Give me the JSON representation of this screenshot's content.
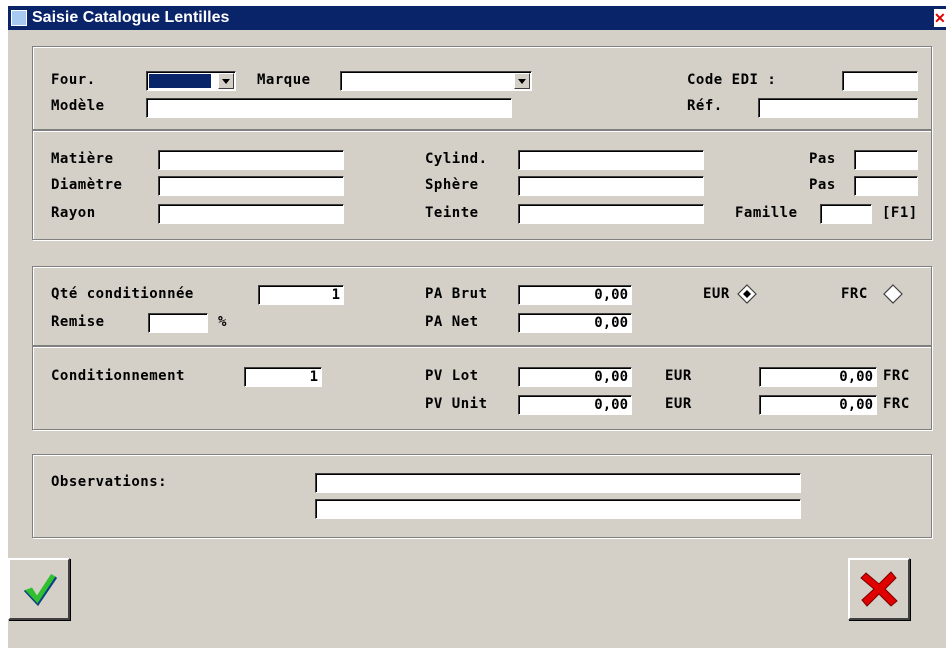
{
  "window": {
    "title": "Saisie Catalogue Lentilles"
  },
  "colors": {
    "titlebar": "#0a246a",
    "face": "#d4d0c8",
    "close": "#e00000",
    "ok_check": "#2fbf2f"
  },
  "identification": {
    "four_label": "Four.",
    "four_value": "",
    "marque_label": "Marque",
    "marque_value": "",
    "code_edi_label": "Code EDI :",
    "code_edi_value": "",
    "modele_label": "Modèle",
    "modele_value": "",
    "ref_label": "Réf.",
    "ref_value": ""
  },
  "characteristics": {
    "matiere_label": "Matière",
    "matiere_value": "",
    "diametre_label": "Diamètre",
    "diametre_value": "",
    "rayon_label": "Rayon",
    "rayon_value": "",
    "cylind_label": "Cylind.",
    "cylind_value": "",
    "sphere_label": "Sphère",
    "sphere_value": "",
    "teinte_label": "Teinte",
    "teinte_value": "",
    "pas1_label": "Pas",
    "pas1_value": "",
    "pas2_label": "Pas",
    "pas2_value": "",
    "famille_label": "Famille",
    "famille_value": "",
    "f1_label": "[F1]"
  },
  "purchase": {
    "qte_label": "Qté conditionnée",
    "qte_value": "1",
    "remise_label": "Remise",
    "remise_value": "",
    "percent": "%",
    "pa_brut_label": "PA Brut",
    "pa_brut_value": "0,00",
    "pa_net_label": "PA Net",
    "pa_net_value": "0,00",
    "currency_eur_label": "EUR",
    "currency_frc_label": "FRC",
    "currency_selected": "EUR"
  },
  "sale": {
    "cond_label": "Conditionnement",
    "cond_value": "1",
    "pv_lot_label": "PV Lot",
    "pv_lot_value": "0,00",
    "pv_lot_eur": "EUR",
    "pv_lot_frc_value": "0,00",
    "pv_lot_frc": "FRC",
    "pv_unit_label": "PV Unit",
    "pv_unit_value": "0,00",
    "pv_unit_eur": "EUR",
    "pv_unit_frc_value": "0,00",
    "pv_unit_frc": "FRC"
  },
  "observations": {
    "label": "Observations:",
    "line1": "",
    "line2": ""
  },
  "buttons": {
    "ok_icon": "checkmark-icon",
    "cancel_icon": "red-x-icon"
  }
}
